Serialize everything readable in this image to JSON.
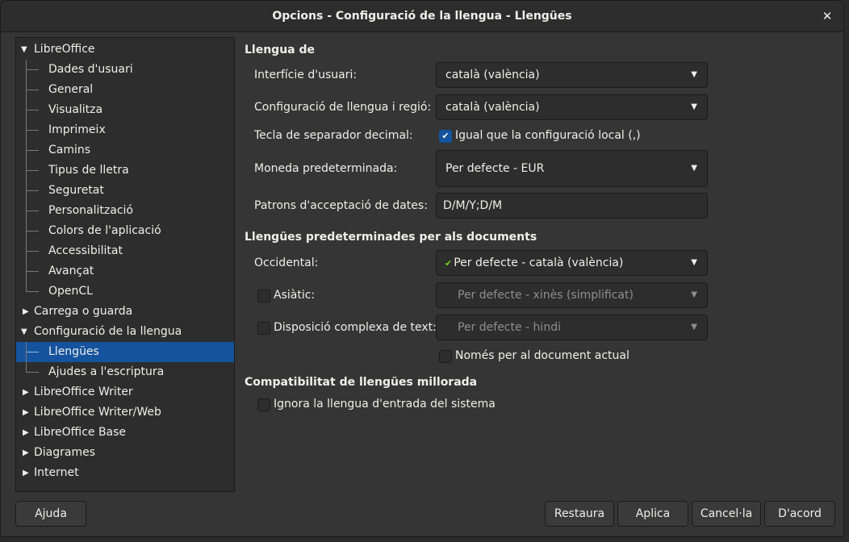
{
  "window": {
    "title": "Opcions - Configuració de la llengua - Llengües"
  },
  "tree": {
    "root": "LibreOffice",
    "items": [
      "Dades d'usuari",
      "General",
      "Visualitza",
      "Imprimeix",
      "Camins",
      "Tipus de lletra",
      "Seguretat",
      "Personalització",
      "Colors de l'aplicació",
      "Accessibilitat",
      "Avançat",
      "OpenCL"
    ],
    "carrega": "Carrega o guarda",
    "config": "Configuració de la llengua",
    "config_children": [
      "Llengües",
      "Ajudes a l'escriptura"
    ],
    "others": [
      "LibreOffice Writer",
      "LibreOffice Writer/Web",
      "LibreOffice Base",
      "Diagrames",
      "Internet"
    ]
  },
  "lang_section": {
    "title": "Llengua de",
    "ui_label": "Interfície d'usuari:",
    "ui_value": "català (valència)",
    "locale_label": "Configuració de llengua i regió:",
    "locale_value": "català (valència)",
    "decimal_label": "Tecla de separador decimal:",
    "decimal_check": "Igual que la configuració local (,)",
    "currency_label": "Moneda predeterminada:",
    "currency_value": "Per defecte - EUR",
    "dates_label": "Patrons d'acceptació de dates:",
    "dates_value": "D/M/Y;D/M"
  },
  "doc_section": {
    "title": "Llengües predeterminades per als documents",
    "western_label": "Occidental:",
    "western_value": "Per defecte - català (valència)",
    "asian_label": "Asiàtic:",
    "asian_value": "Per defecte - xinès (simplificat)",
    "ctl_label": "Disposició complexa de text:",
    "ctl_value": "Per defecte - hindi",
    "only_current": "Només per al document actual"
  },
  "enh_section": {
    "title": "Compatibilitat de llengües millorada",
    "ignore": "Ignora la llengua d'entrada del sistema"
  },
  "buttons": {
    "help": "Ajuda",
    "reset": "Restaura",
    "apply": "Aplica",
    "cancel": "Cancel·la",
    "ok": "D'acord"
  }
}
